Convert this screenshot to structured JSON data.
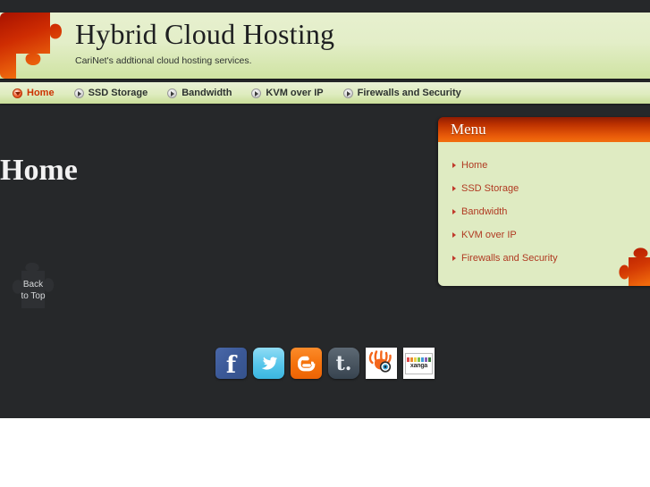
{
  "site": {
    "title": "Hybrid Cloud Hosting",
    "tagline": "CariNet's addtional cloud hosting services.",
    "logo_icon": "puzzle-piece-icon"
  },
  "nav": {
    "items": [
      {
        "label": "Home",
        "active": true,
        "icon": "circle-down-arrow-icon"
      },
      {
        "label": "SSD Storage",
        "active": false,
        "icon": "circle-right-arrow-icon"
      },
      {
        "label": "Bandwidth",
        "active": false,
        "icon": "circle-right-arrow-icon"
      },
      {
        "label": "KVM over IP",
        "active": false,
        "icon": "circle-right-arrow-icon"
      },
      {
        "label": "Firewalls and Security",
        "active": false,
        "icon": "circle-right-arrow-icon"
      }
    ]
  },
  "main": {
    "page_title": "Home"
  },
  "sidebar": {
    "header": "Menu",
    "decoration_icon": "puzzle-piece-icon",
    "items": [
      {
        "label": "Home"
      },
      {
        "label": "SSD Storage"
      },
      {
        "label": "Bandwidth"
      },
      {
        "label": "KVM over IP"
      },
      {
        "label": "Firewalls and Security"
      }
    ]
  },
  "back_to_top": {
    "line1": "Back",
    "line2": "to Top",
    "icon": "puzzle-piece-icon"
  },
  "social": {
    "items": [
      {
        "name": "facebook",
        "glyph": "f",
        "icon": "facebook-icon"
      },
      {
        "name": "twitter",
        "glyph": "t",
        "icon": "twitter-icon"
      },
      {
        "name": "blogger",
        "glyph": "B",
        "icon": "blogger-icon"
      },
      {
        "name": "tumblr",
        "glyph": "t.",
        "icon": "tumblr-icon"
      },
      {
        "name": "squidoo",
        "glyph": "",
        "icon": "squidoo-icon"
      },
      {
        "name": "xanga",
        "glyph": "xanga",
        "icon": "xanga-icon"
      }
    ]
  },
  "colors": {
    "page_background": "#26282a",
    "header_green": "#dfecc0",
    "accent_orange": "#e85a09",
    "accent_red": "#cc3300",
    "link_red": "#b03a22",
    "sidebar_body": "#dfebc2"
  }
}
